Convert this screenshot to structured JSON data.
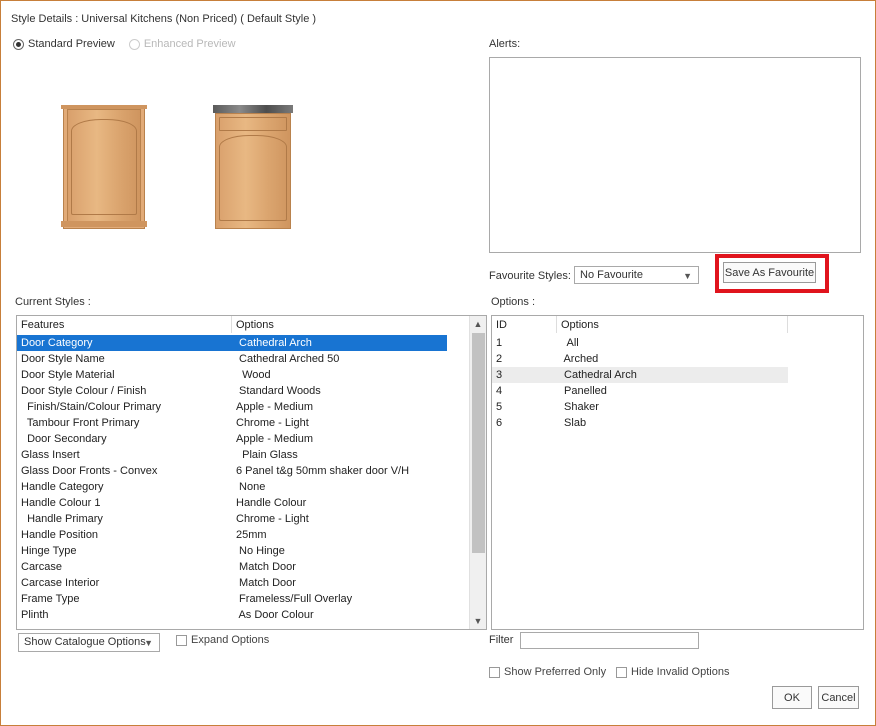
{
  "window": {
    "title": "Style Details : Universal Kitchens (Non Priced) ( Default Style )"
  },
  "preview": {
    "standard_label": "Standard Preview",
    "enhanced_label": "Enhanced Preview"
  },
  "alerts": {
    "label": "Alerts:"
  },
  "favourites": {
    "label": "Favourite Styles:",
    "selected": "No Favourite",
    "save_label": "Save As Favourite"
  },
  "current_styles": {
    "label": "Current Styles :",
    "headers": [
      "Features",
      "Options"
    ],
    "rows": [
      {
        "feature": "Door Category",
        "option": " Cathedral Arch"
      },
      {
        "feature": "Door Style Name",
        "option": " Cathedral Arched 50"
      },
      {
        "feature": "Door Style Material",
        "option": "  Wood"
      },
      {
        "feature": "Door Style Colour / Finish",
        "option": " Standard Woods"
      },
      {
        "feature": "  Finish/Stain/Colour Primary",
        "option": "Apple - Medium"
      },
      {
        "feature": "  Tambour Front Primary",
        "option": "Chrome - Light"
      },
      {
        "feature": "  Door Secondary",
        "option": "Apple - Medium"
      },
      {
        "feature": "Glass Insert",
        "option": "  Plain Glass"
      },
      {
        "feature": "Glass Door Fronts - Convex",
        "option": "6 Panel t&g 50mm shaker door V/H"
      },
      {
        "feature": "Handle Category",
        "option": " None"
      },
      {
        "feature": "Handle Colour 1",
        "option": "Handle Colour"
      },
      {
        "feature": "  Handle Primary",
        "option": "Chrome - Light"
      },
      {
        "feature": "Handle Position",
        "option": "25mm"
      },
      {
        "feature": "Hinge Type",
        "option": " No Hinge"
      },
      {
        "feature": "Carcase",
        "option": " Match Door"
      },
      {
        "feature": "Carcase Interior",
        "option": " Match Door"
      },
      {
        "feature": "Frame Type",
        "option": " Frameless/Full Overlay"
      },
      {
        "feature": "Plinth",
        "option": " As Door Colour"
      }
    ],
    "show_catalogue_label": "Show Catalogue Options",
    "expand_label": "Expand Options"
  },
  "options_panel": {
    "label": "Options :",
    "headers": [
      "ID",
      "Options"
    ],
    "rows": [
      {
        "id": "1",
        "option": "  All"
      },
      {
        "id": "2",
        "option": " Arched"
      },
      {
        "id": "3",
        "option": " Cathedral Arch"
      },
      {
        "id": "4",
        "option": " Panelled"
      },
      {
        "id": "5",
        "option": " Shaker"
      },
      {
        "id": "6",
        "option": " Slab"
      }
    ],
    "filter_label": "Filter",
    "preferred_label": "Show Preferred Only",
    "hide_invalid_label": "Hide Invalid Options"
  },
  "footer": {
    "ok_label": "OK",
    "cancel_label": "Cancel"
  },
  "colors": {
    "accent_selected": "#1874d2",
    "highlight_border": "#e0141d",
    "window_border": "#c77f3a"
  }
}
